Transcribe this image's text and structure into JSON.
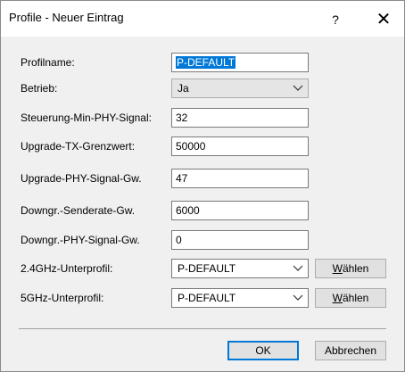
{
  "window": {
    "title": "Profile - Neuer Eintrag",
    "help_glyph": "?",
    "close_glyph": "✕"
  },
  "fields": [
    {
      "label": "Profilname:",
      "value": "P-DEFAULT"
    },
    {
      "label": "Betrieb:",
      "value": "Ja"
    },
    {
      "label": "Steuerung-Min-PHY-Signal:",
      "value": "32"
    },
    {
      "label": "Upgrade-TX-Grenzwert:",
      "value": "50000"
    },
    {
      "label": "Upgrade-PHY-Signal-Gw.",
      "value": "47"
    },
    {
      "label": "Downgr.-Senderate-Gw.",
      "value": "6000"
    },
    {
      "label": "Downgr.-PHY-Signal-Gw.",
      "value": "0"
    },
    {
      "label": "2.4GHz-Unterprofil:",
      "value": "P-DEFAULT"
    },
    {
      "label": "5GHz-Unterprofil:",
      "value": "P-DEFAULT"
    }
  ],
  "buttons": {
    "choose_first": "W",
    "choose_rest": "ählen",
    "ok": "OK",
    "cancel": "Abbrechen"
  },
  "colors": {
    "selection": "#0078d7",
    "title_bg": "#ffffff",
    "dialog_bg": "#f0f0f0"
  }
}
